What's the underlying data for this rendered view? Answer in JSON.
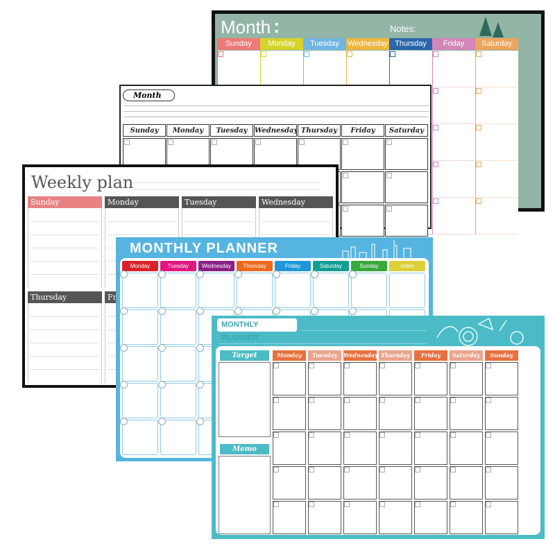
{
  "green_board": {
    "title": "Month",
    "colon": ":",
    "notes_label": "Notes:",
    "days": [
      "Sunday",
      "Monday",
      "Tuesday",
      "Wednesday",
      "Thursday",
      "Friday",
      "Saturday"
    ],
    "day_colors": [
      "#ee7a78",
      "#d6d42a",
      "#6fb6e3",
      "#eeb63e",
      "#2a66a9",
      "#d386b8",
      "#eea45a"
    ],
    "bg_color": "#93b5a5",
    "tree_icon": "pine-trees-icon"
  },
  "month_board": {
    "title": "Month",
    "days": [
      "Sunday",
      "Monday",
      "Tuesday",
      "Wednesday",
      "Thursday",
      "Friday",
      "Saturday"
    ]
  },
  "weekly_board": {
    "title": "Weekly plan",
    "days": [
      "Sunday",
      "Monday",
      "Tuesday",
      "Wednesday"
    ],
    "day_colors": [
      "#e98282",
      "#555555",
      "#555555",
      "#555555"
    ],
    "second_row_days": [
      "Thursday",
      "Fr"
    ]
  },
  "blue_board": {
    "title": "MONTHLY PLANNER",
    "days": [
      "Monday",
      "Tuesday",
      "Wednesday",
      "Thursday",
      "Friday",
      "Saturday",
      "Sunday",
      "notes"
    ],
    "day_colors": [
      "#d9232a",
      "#e0157f",
      "#8a1f86",
      "#ec6a1c",
      "#1f97d8",
      "#129d93",
      "#38a83a",
      "#dcd03a"
    ],
    "bg_color": "#56b4e0",
    "skyline_icon": "city-skyline-icon"
  },
  "teal_board": {
    "title": "MONTHLY PLANNER",
    "target_label": "Target",
    "memo_label": "Memo",
    "days": [
      "Monday",
      "Tuesday",
      "Wednesday",
      "Thursday",
      "Friday",
      "Saturday",
      "Sunday"
    ],
    "day_colors": [
      "#e8703f",
      "#eba48d",
      "#e8703f",
      "#eba48d",
      "#e8703f",
      "#eba48d",
      "#e8703f"
    ],
    "bg_color": "#4bbcc6",
    "flower_icon": "rose-flowers-icon"
  }
}
